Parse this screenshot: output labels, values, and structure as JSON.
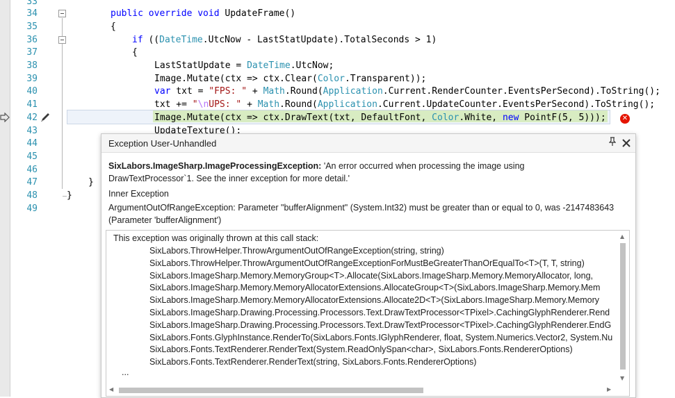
{
  "line_numbers": [
    "33",
    "34",
    "35",
    "36",
    "37",
    "38",
    "39",
    "40",
    "41",
    "42",
    "43",
    "44",
    "45",
    "46",
    "47",
    "48",
    "49"
  ],
  "code": {
    "l34": {
      "kw1": "public override void",
      "name": " UpdateFrame()"
    },
    "l35": "{",
    "l36": {
      "kw": "if",
      "a": " ((",
      "ty": "DateTime",
      "b": ".UtcNow - LastStatUpdate).TotalSeconds > 1)"
    },
    "l37": "{",
    "l38": {
      "a": "LastStatUpdate = ",
      "ty": "DateTime",
      "b": ".UtcNow;"
    },
    "l39": {
      "a": "Image",
      "b": ".Mutate(ctx => ctx.Clear(",
      "ty": "Color",
      "c": ".Transparent));"
    },
    "l40": {
      "kw": "var",
      "a": " txt = ",
      "str": "\"FPS: \"",
      "b": " + ",
      "ty1": "Math",
      "c": ".Round(",
      "ty2": "Application",
      "d": ".Current.RenderCounter.EventsPerSecond).ToString();"
    },
    "l41": {
      "a": "txt += ",
      "str1": "\"",
      "esc": "\\n",
      "str2": "UPS: \"",
      "b": " + ",
      "ty1": "Math",
      "c": ".Round(",
      "ty2": "Application",
      "d": ".Current.UpdateCounter.EventsPerSecond).ToString();"
    },
    "l42": {
      "a": "Image.Mutate(ctx => ctx.DrawText(txt, DefaultFont, ",
      "ty": "Color",
      "b": ".White, ",
      "kw": "new",
      "c": " PointF(5, 5)));"
    },
    "l43": "UpdateTexture();",
    "l47": "}",
    "l48": "}"
  },
  "exception": {
    "title": "Exception User-Unhandled",
    "type": "SixLabors.ImageSharp.ImageProcessingException:",
    "message": " 'An error occurred when processing the image using DrawTextProcessor`1. See the inner exception for more detail.'",
    "inner_label": "Inner Exception",
    "inner_message": "ArgumentOutOfRangeException: Parameter \"bufferAlignment\" (System.Int32) must be greater than or equal to 0, was -2147483643 (Parameter 'bufferAlignment')",
    "stack_intro": "This exception was originally thrown at this call stack:",
    "stack": [
      "SixLabors.ThrowHelper.ThrowArgumentOutOfRangeException(string, string)",
      "SixLabors.ThrowHelper.ThrowArgumentOutOfRangeExceptionForMustBeGreaterThanOrEqualTo<T>(T, T, string)",
      "SixLabors.ImageSharp.Memory.MemoryGroup<T>.Allocate(SixLabors.ImageSharp.Memory.MemoryAllocator, long,",
      "SixLabors.ImageSharp.Memory.MemoryAllocatorExtensions.AllocateGroup<T>(SixLabors.ImageSharp.Memory.Mem",
      "SixLabors.ImageSharp.Memory.MemoryAllocatorExtensions.Allocate2D<T>(SixLabors.ImageSharp.Memory.Memory",
      "SixLabors.ImageSharp.Drawing.Processing.Processors.Text.DrawTextProcessor<TPixel>.CachingGlyphRenderer.Rend",
      "SixLabors.ImageSharp.Drawing.Processing.Processors.Text.DrawTextProcessor<TPixel>.CachingGlyphRenderer.EndG",
      "SixLabors.Fonts.GlyphInstance.RenderTo(SixLabors.Fonts.IGlyphRenderer, float, System.Numerics.Vector2, System.Nu",
      "SixLabors.Fonts.TextRenderer.RenderText(System.ReadOnlySpan<char>, SixLabors.Fonts.RendererOptions)",
      "SixLabors.Fonts.TextRenderer.RenderText(string, SixLabors.Fonts.RendererOptions)"
    ],
    "ellipsis": "..."
  },
  "icons": {
    "pin": "pin-icon",
    "close": "close-icon",
    "error": "error-icon",
    "arrow": "execution-arrow-icon",
    "pencil": "pencil-icon"
  }
}
